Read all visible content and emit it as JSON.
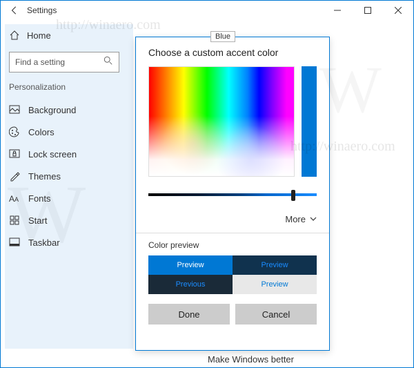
{
  "window": {
    "title": "Settings"
  },
  "sidebar": {
    "home": "Home",
    "search_placeholder": "Find a setting",
    "section": "Personalization",
    "items": [
      {
        "icon": "background-icon",
        "label": "Background"
      },
      {
        "icon": "colors-icon",
        "label": "Colors"
      },
      {
        "icon": "lock-screen-icon",
        "label": "Lock screen"
      },
      {
        "icon": "themes-icon",
        "label": "Themes"
      },
      {
        "icon": "fonts-icon",
        "label": "Fonts"
      },
      {
        "icon": "start-icon",
        "label": "Start"
      },
      {
        "icon": "taskbar-icon",
        "label": "Taskbar"
      }
    ]
  },
  "dialog": {
    "title": "Choose a custom accent color",
    "more": "More",
    "preview_label": "Color preview",
    "preview_tiles": [
      "Preview",
      "Preview",
      "Previous",
      "Preview"
    ],
    "done": "Done",
    "cancel": "Cancel",
    "selected_color": "#0078d4"
  },
  "tooltip": {
    "text": "Blue"
  },
  "footer": {
    "text": "Make Windows better"
  },
  "watermark": {
    "letter": "W",
    "url": "http://winaero.com"
  }
}
